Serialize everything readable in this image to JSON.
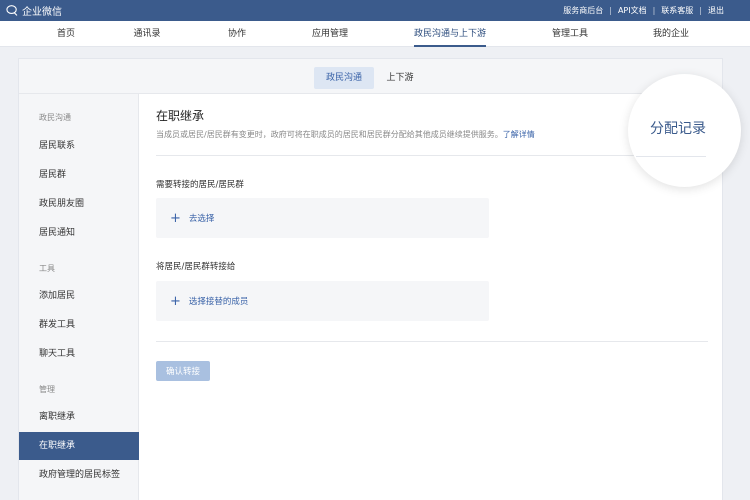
{
  "topbar": {
    "brand": "企业微信",
    "links": [
      "服务商后台",
      "API文档",
      "联系客服",
      "退出"
    ]
  },
  "nav": {
    "items": [
      "首页",
      "通讯录",
      "协作",
      "应用管理",
      "政民沟通与上下游",
      "管理工具",
      "我的企业"
    ],
    "active_index": 4
  },
  "subtabs": {
    "items": [
      "政民沟通",
      "上下游"
    ],
    "active_index": 0
  },
  "sidebar": {
    "groups": [
      {
        "title": "政民沟通",
        "items": [
          "居民联系",
          "居民群",
          "政民朋友圈",
          "居民通知"
        ]
      },
      {
        "title": "工具",
        "items": [
          "添加居民",
          "群发工具",
          "聊天工具"
        ]
      },
      {
        "title": "管理",
        "items": [
          "离职继承",
          "在职继承",
          "政府管理的居民标签"
        ]
      }
    ],
    "active_item": "在职继承"
  },
  "main": {
    "title": "在职继承",
    "description": "当成员或居民/居民群有变更时，政府可将在职成员的居民和居民群分配给其他成员继续提供服务。",
    "learn_more": "了解详情",
    "field1_label": "需要转接的居民/居民群",
    "field1_action": "去选择",
    "field2_label": "将居民/居民群转接给",
    "field2_action": "选择接替的成员",
    "confirm_label": "确认转接"
  },
  "magnifier": {
    "label": "分配记录"
  },
  "colors": {
    "topbar": "#3b5b8c",
    "accent": "#3a63a8",
    "active_side": "#3b5b8c",
    "disabled_button": "#a9c0e0"
  }
}
